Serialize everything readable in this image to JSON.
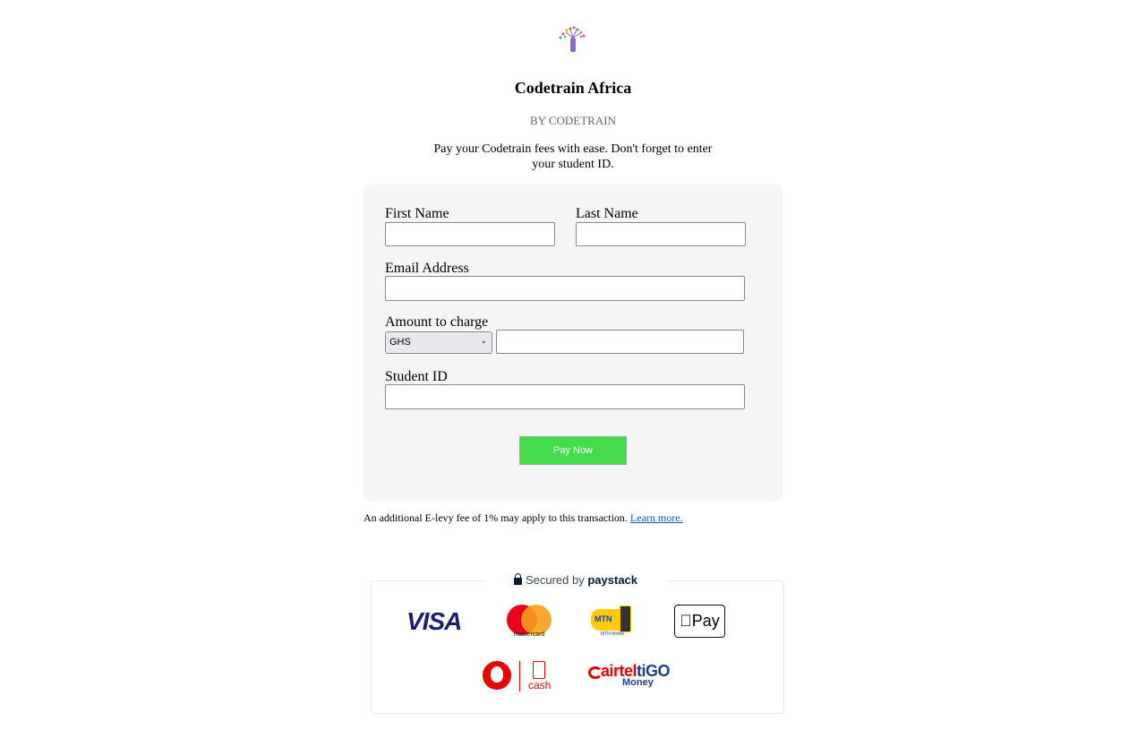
{
  "header": {
    "title": "Codetrain Africa",
    "byline": "BY CODETRAIN",
    "description": "Pay your Codetrain fees with ease. Don't forget to enter your student ID."
  },
  "form": {
    "first_name_label": "First Name",
    "first_name_value": "",
    "last_name_label": "Last Name",
    "last_name_value": "",
    "email_label": "Email Address",
    "email_value": "",
    "amount_label": "Amount to charge",
    "currency_selected": "GHS",
    "amount_value": "",
    "student_id_label": "Student ID",
    "student_id_value": "",
    "submit_label": "Pay Now"
  },
  "footer": {
    "levy_text": "An additional E-levy fee of 1% may apply to this transaction.",
    "learn_more": "Learn more.",
    "secured_prefix": "Secured by",
    "secured_brand": "paystack"
  },
  "payment_logos": {
    "visa": "VISA",
    "mastercard_caption": "mastercard",
    "mtn_label": "MTN",
    "mtn_caption": "MTN MoMo",
    "applepay": "Pay",
    "vodafone_caption": "cash",
    "airteltigo_main": "airtel",
    "airteltigo_tigo": "tiGO",
    "airteltigo_caption": "Money"
  },
  "colors": {
    "card_bg": "#f5f5f5",
    "button_bg": "#44dc4a",
    "link": "#0a58ca"
  }
}
